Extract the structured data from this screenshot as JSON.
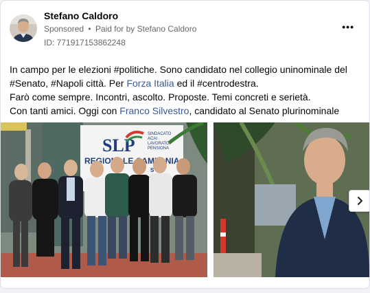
{
  "post": {
    "author": "Stefano Caldoro",
    "sponsored_label": "Sponsored",
    "paid_for_prefix": "Paid for by",
    "paid_for_name": "Stefano Caldoro",
    "ad_id": "ID: 771917153862248",
    "more_label": "•••",
    "text": {
      "line1": "In campo per le elezioni #politiche. Sono candidato nel collegio uninominale del",
      "line2_prefix": "#Senato, #Napoli città. Per ",
      "line2_link": "Forza Italia",
      "line2_suffix": " ed il #centrodestra.",
      "line3": "Farò come sempre. Incontri, ascolto. Proposte. Temi concreti e serietà.",
      "line4_prefix": "Con tanti amici. Oggi con ",
      "line4_link": "Franco Silvestro",
      "line4_suffix": ", candidato al Senato plurinominale"
    }
  },
  "media": {
    "banner_brand": "SLP",
    "banner_small_lines": [
      "SINDACATO",
      "ACAI",
      "LAVORATO",
      "PENSIONA"
    ],
    "banner_regional": "REGIONALE CAMPANIA",
    "banner_partial": "S"
  },
  "colors": {
    "link": "#385898",
    "secondary_text": "#65676b",
    "banner_blue": "#1f3e7a",
    "banner_red": "#d23a2e"
  },
  "icons": {
    "next": "chevron-right-icon",
    "more": "more-horizontal-icon"
  }
}
